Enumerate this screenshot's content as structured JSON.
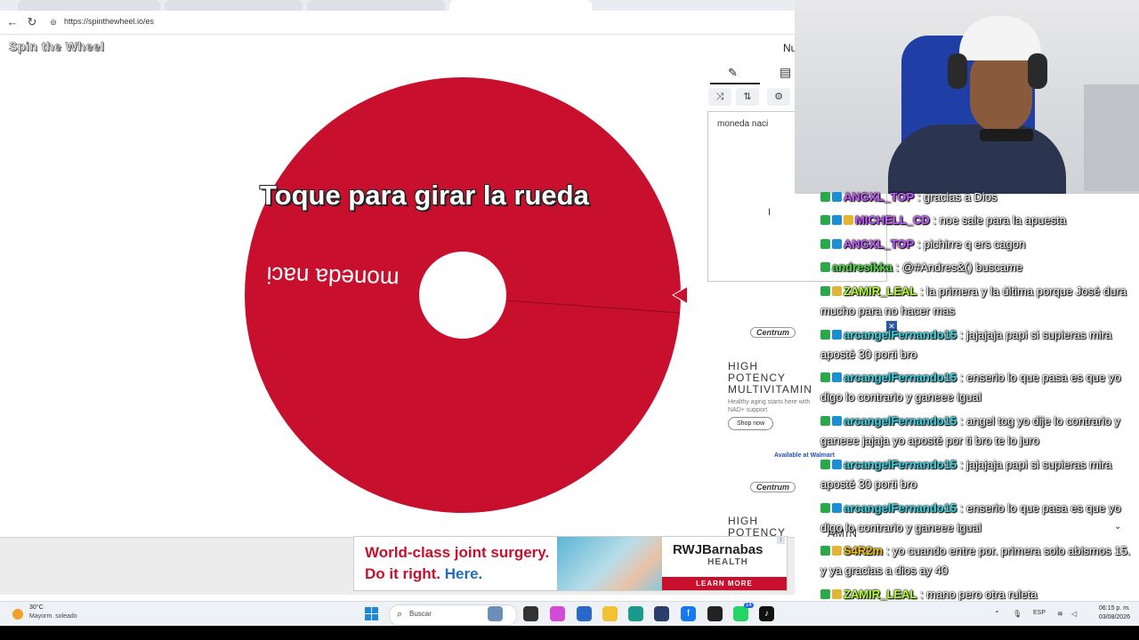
{
  "browser": {
    "url": "https://spinthewheel.io/es"
  },
  "page": {
    "logo": "Spin the Wheel",
    "nu_label": "Nu",
    "entries_text": "moneda naci",
    "wheel": {
      "prompt": "Toque para girar la rueda",
      "entry_label": "moneda naci",
      "color": "#c8102e"
    }
  },
  "ads": {
    "centrum": {
      "brand": "Centrum",
      "headline_1": "HIGH",
      "headline_2": "POTENCY",
      "headline_3": "MULTIVITAMIN",
      "sub": "Healthy aging starts here with NAD+ support",
      "shop": "Shop now",
      "available": "Available at Walmart",
      "headline_3b": "AMIN"
    },
    "rwj": {
      "line1": "World-class joint surgery.",
      "line2a": "Do it right. ",
      "line2b": "Here.",
      "brand1": "RWJBarnabas",
      "brand2": "HEALTH",
      "cta": "LEARN MORE"
    }
  },
  "chat": [
    {
      "user": "ANGXL_TOP",
      "color": "#c45bff",
      "badges": [
        "k",
        "b"
      ],
      "text": " : gracias a Dios"
    },
    {
      "user": "MICHELL_CD",
      "color": "#c45bff",
      "badges": [
        "k",
        "b",
        "y"
      ],
      "text": " : noe sale para la apuesta"
    },
    {
      "user": "ANGXL_TOP",
      "color": "#c45bff",
      "badges": [
        "k",
        "b"
      ],
      "text": " : pichirre q ers cagon"
    },
    {
      "user": "andresikka",
      "color": "#4fdc48",
      "badges": [
        "k"
      ],
      "text": " : @#Andres&() buscame"
    },
    {
      "user": "ZAMIR_LEAL",
      "color": "#b6ff2a",
      "badges": [
        "k",
        "y"
      ],
      "text": " : la primera y la última porque José dura mucho para no hacer mas"
    },
    {
      "user": "arcangelFernando15",
      "color": "#39d6e6",
      "badges": [
        "k",
        "b"
      ],
      "text": " : jajajaja papi si supieras mira aposté 30 porti bro"
    },
    {
      "user": "arcangelFernando15",
      "color": "#39d6e6",
      "badges": [
        "k",
        "b"
      ],
      "text": " : enserio lo que pasa es que yo digo lo contrario y ganeee igual"
    },
    {
      "user": "arcangelFernando15",
      "color": "#39d6e6",
      "badges": [
        "k",
        "b"
      ],
      "text": " : angel tog yo dije lo contrario y ganeee jajaja yo aposté por ti bro te lo juro"
    },
    {
      "user": "arcangelFernando15",
      "color": "#39d6e6",
      "badges": [
        "k",
        "b"
      ],
      "text": " : jajajaja papi si supieras mira aposté 30 porti bro"
    },
    {
      "user": "arcangelFernando15",
      "color": "#39d6e6",
      "badges": [
        "k",
        "b"
      ],
      "text": " : enserio lo que pasa es que yo digo lo contrario y ganeee igual"
    },
    {
      "user": "S4R2m",
      "color": "#f0c400",
      "badges": [
        "k",
        "y"
      ],
      "text": " : yo cuando entre por. primera solo abismos 15. y ya gracias a dios ay 40"
    },
    {
      "user": "ZAMIR_LEAL",
      "color": "#b6ff2a",
      "badges": [
        "k",
        "y"
      ],
      "text": " : mano pero otra ruleta"
    }
  ],
  "taskbar": {
    "weather_temp": "30°C",
    "weather_desc": "Mayorm. soleado",
    "search": "Buscar",
    "lang": "ESP",
    "time": "06:15 p. m.",
    "date": "03/08/2026",
    "notif_count": "14"
  }
}
